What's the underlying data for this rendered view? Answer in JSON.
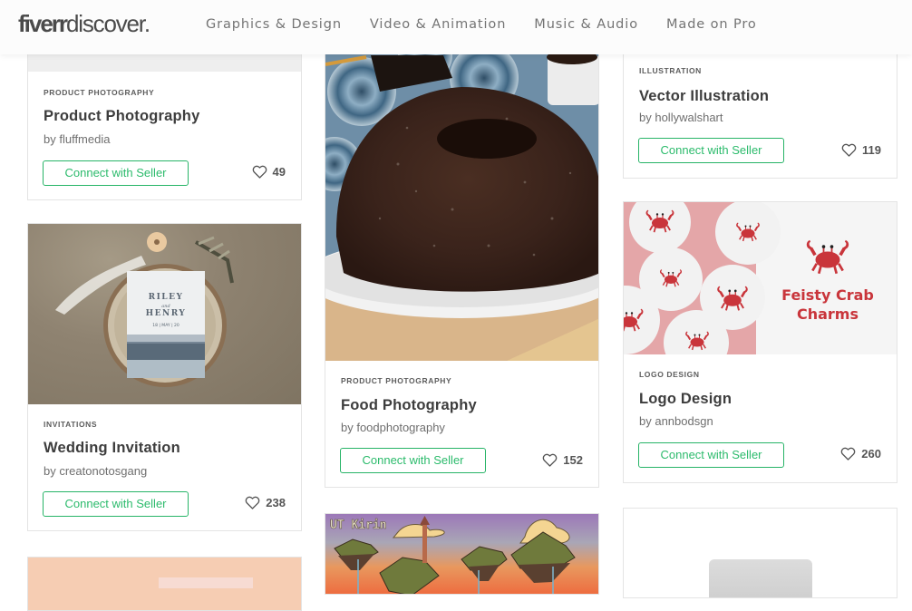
{
  "header": {
    "logo_brand": "fiverr",
    "logo_rest": "discover.",
    "nav": [
      {
        "label": "Graphics & Design"
      },
      {
        "label": "Video & Animation"
      },
      {
        "label": "Music & Audio"
      },
      {
        "label": "Made on Pro"
      }
    ]
  },
  "accent_color": "#2cbb6c",
  "cards": [
    {
      "category": "PRODUCT PHOTOGRAPHY",
      "title": "Product Photography",
      "by": "by fluffmedia",
      "button": "Connect with Seller",
      "likes": "49",
      "icon": "heart-icon"
    },
    {
      "category": "INVITATIONS",
      "title": "Wedding Invitation",
      "by": "by creatonotosgang",
      "button": "Connect with Seller",
      "likes": "238",
      "icon": "heart-icon",
      "image_text": {
        "line1": "RILEY",
        "amp": "and",
        "line2": "HENRY",
        "date": "18 | MAY | 20"
      }
    },
    {
      "category": "PRODUCT PHOTOGRAPHY",
      "title": "Food Photography",
      "by": "by foodphotography",
      "button": "Connect with Seller",
      "likes": "152",
      "icon": "heart-icon"
    },
    {
      "image_text": "UT Kirin"
    },
    {
      "category": "ILLUSTRATION",
      "title": "Vector Illustration",
      "by": "by hollywalshart",
      "button": "Connect with Seller",
      "likes": "119",
      "icon": "heart-icon"
    },
    {
      "category": "LOGO DESIGN",
      "title": "Logo Design",
      "by": "by annbodsgn",
      "button": "Connect with Seller",
      "likes": "260",
      "icon": "heart-icon",
      "image_text": {
        "brand_line1": "Feisty Crab",
        "brand_line2": "Charms"
      }
    }
  ]
}
